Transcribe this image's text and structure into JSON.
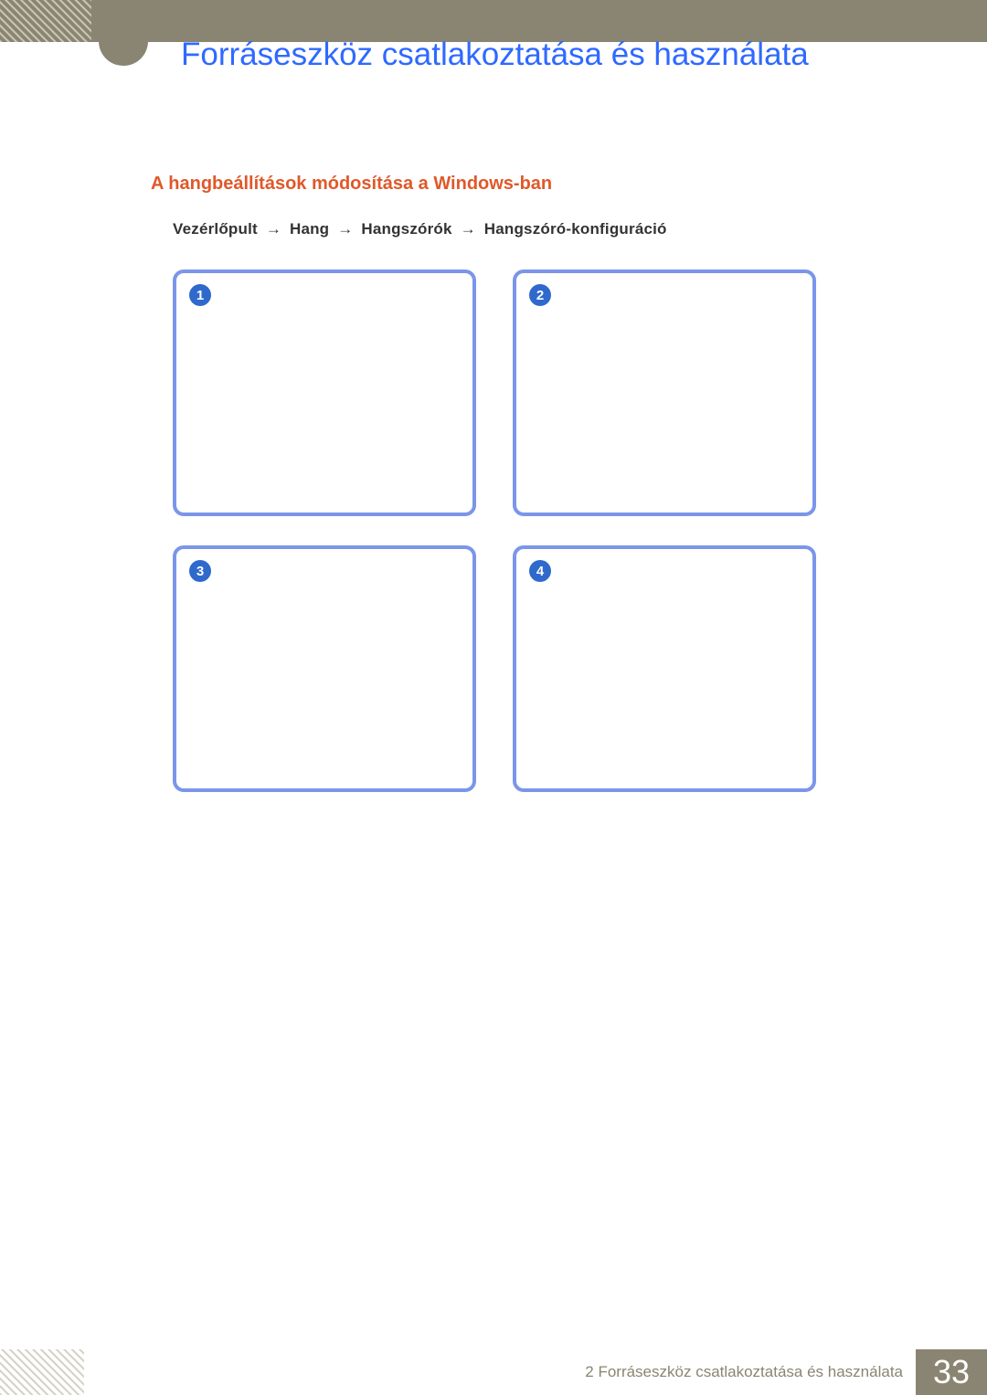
{
  "header": {
    "chapter_title": "Forráseszköz csatlakoztatása és használata"
  },
  "section": {
    "heading": "A hangbeállítások módosítása a Windows-ban",
    "nav_path_parts": [
      "Vezérlőpult",
      "Hang",
      "Hangszórók",
      "Hangszóró-konfiguráció"
    ]
  },
  "steps": {
    "badges": [
      "1",
      "2",
      "3",
      "4"
    ]
  },
  "footer": {
    "label": "2 Forráseszköz csatlakoztatása és használata",
    "page_number": "33"
  }
}
